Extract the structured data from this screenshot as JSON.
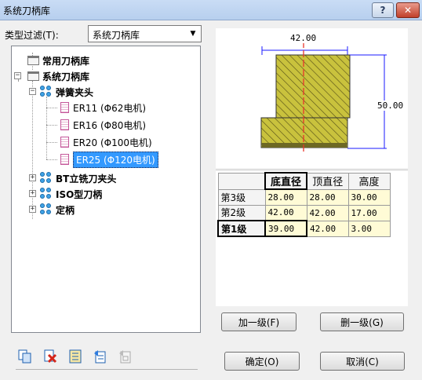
{
  "window": {
    "title": "系统刀柄库",
    "help_label": "?",
    "close_label": "✕"
  },
  "filter": {
    "label": "类型过滤(T):",
    "value": "系统刀柄库"
  },
  "tree": {
    "common_library": "常用刀柄库",
    "system_library": "系统刀柄库",
    "collet_chuck": "弹簧夹头",
    "er11": "ER11 (Φ62电机)",
    "er16": "ER16 (Φ80电机)",
    "er20": "ER20 (Φ100电机)",
    "er25": "ER25 (Φ120电机)",
    "bt_holder": "BT立铣刀夹头",
    "iso_holder": "ISO型刀柄",
    "fixed_holder": "定柄"
  },
  "preview": {
    "top_dimension": "42.00",
    "height_dimension": "50.00"
  },
  "table": {
    "headers": [
      "底直径",
      "顶直径",
      "高度"
    ],
    "rows": [
      {
        "label": "第3级",
        "bottom": "28.00",
        "top": "28.00",
        "height": "30.00"
      },
      {
        "label": "第2级",
        "bottom": "42.00",
        "top": "42.00",
        "height": "17.00"
      },
      {
        "label": "第1级",
        "bottom": "39.00",
        "top": "42.00",
        "height": "3.00"
      }
    ]
  },
  "buttons": {
    "add_level": "加一级(F)",
    "delete_level": "删一级(G)",
    "ok": "确定(O)",
    "cancel": "取消(C)"
  },
  "colors": {
    "selection": "#3399ff",
    "hatch_fill": "#c9c23d",
    "cell_fill": "#fffbd6",
    "axis_line": "#e8352b",
    "dimension_line": "#1a1aff"
  }
}
